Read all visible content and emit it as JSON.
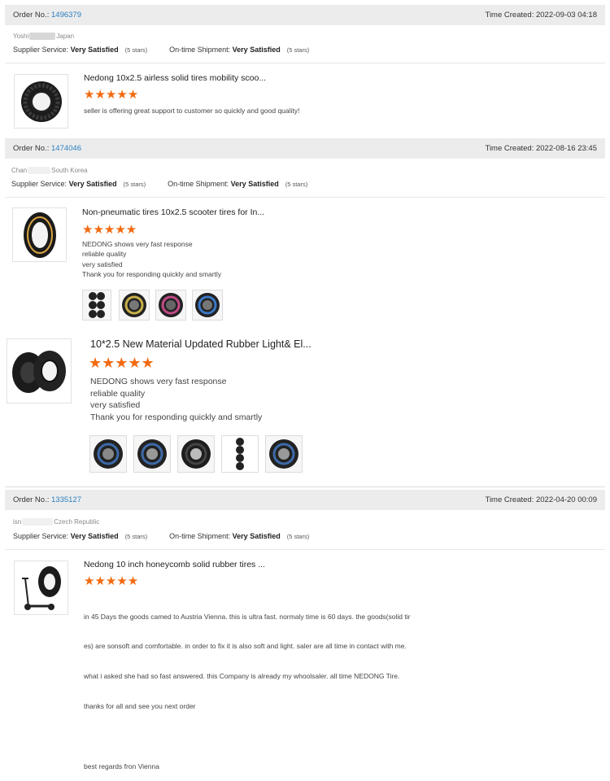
{
  "orders": [
    {
      "order_label": "Order No.:",
      "order_number": "1496379",
      "time_label": "Time Created:",
      "time_created": "2022-09-03 04:18",
      "buyer_name": "Yoshi",
      "buyer_country": "Japan",
      "supplier_label": "Supplier Service:",
      "supplier_rating": "Very Satisfied",
      "supplier_stars": "(5 stars)",
      "shipment_label": "On-time Shipment:",
      "shipment_rating": "Very Satisfied",
      "shipment_stars": "(5 stars)",
      "products": [
        {
          "title": "Nedong 10x2.5 airless solid tires mobility scoo...",
          "rating": 5,
          "stars": "★★★★★",
          "review_lines": [
            "seller is offering great support to customer so quickly and good quality!"
          ]
        }
      ]
    },
    {
      "order_label": "Order No.:",
      "order_number": "1474046",
      "time_label": "Time Created:",
      "time_created": "2022-08-16 23:45",
      "buyer_name": "Chan",
      "buyer_country": "South Korea",
      "supplier_label": "Supplier Service:",
      "supplier_rating": "Very Satisfied",
      "supplier_stars": "(5 stars)",
      "shipment_label": "On-time Shipment:",
      "shipment_rating": "Very Satisfied",
      "shipment_stars": "(5 stars)",
      "products": [
        {
          "title": "Non-pneumatic tires 10x2.5 scooter tires for In...",
          "rating": 5,
          "stars": "★★★★★",
          "review_lines": [
            "NEDONG shows very fast response",
            "reliable quality",
            "very satisfied",
            "Thank you for responding quickly and smartly"
          ],
          "photo_count": 4
        },
        {
          "title": "10*2.5 New Material Updated Rubber Light& El...",
          "rating": 5,
          "stars": "★★★★★",
          "review_lines": [
            "NEDONG shows very fast response",
            "reliable quality",
            "very satisfied",
            "Thank you for responding quickly and smartly"
          ],
          "photo_count": 5
        }
      ]
    },
    {
      "order_label": "Order No.:",
      "order_number": "1335127",
      "time_label": "Time Created:",
      "time_created": "2022-04-20 00:09",
      "buyer_name": "isn",
      "buyer_country": "Czech Republic",
      "supplier_label": "Supplier Service:",
      "supplier_rating": "Very Satisfied",
      "supplier_stars": "(5 stars)",
      "shipment_label": "On-time Shipment:",
      "shipment_rating": "Very Satisfied",
      "shipment_stars": "(5 stars)",
      "products": [
        {
          "title": "Nedong 10 inch honeycomb solid rubber tires ...",
          "rating": 5,
          "stars": "★★★★★",
          "review_lines": [
            "in 45 Days the goods camed to Austria Vienna. this is ultra fast. normaly time is 60 days. the goods(solid tir",
            "es) are sonsoft and comfortable. in order to fix it is also soft and light. saler are all time in contact with me.",
            "what i asked she had so fast answered. this Company is already my whoolsaler. all time NEDONG Tire.",
            "thanks for all and see you next order",
            "",
            "best regards fron Vienna"
          ]
        }
      ]
    }
  ],
  "colors": {
    "star": "#f26a10",
    "link": "#2a7fc1",
    "bar": "#ececec"
  },
  "icons": {
    "tire": "tire-icon",
    "scooter": "scooter-icon"
  }
}
